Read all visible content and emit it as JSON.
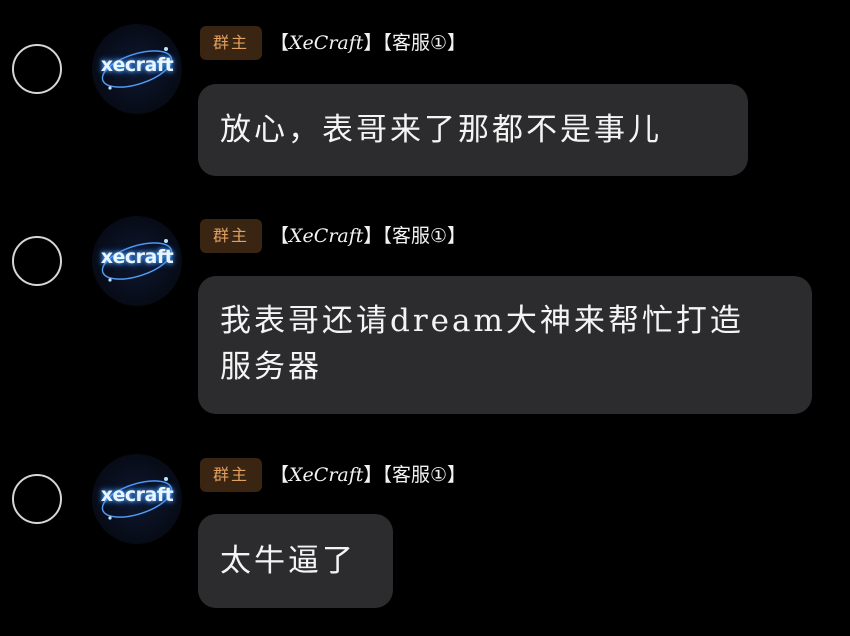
{
  "messages": [
    {
      "role_badge": "群主",
      "tag_open_1": "【",
      "sender_name": "XeCraft",
      "tag_close_1": "】",
      "tag_open_2": "【",
      "sender_role": "客服①",
      "tag_close_2": "】",
      "avatar_text": "xecraft",
      "lines": [
        "放心，表哥来了那都不是事儿"
      ]
    },
    {
      "role_badge": "群主",
      "tag_open_1": "【",
      "sender_name": "XeCraft",
      "tag_close_1": "】",
      "tag_open_2": "【",
      "sender_role": "客服①",
      "tag_close_2": "】",
      "avatar_text": "xecraft",
      "lines": [
        "我表哥还请dream大神来帮忙打造",
        "服务器"
      ]
    },
    {
      "role_badge": "群主",
      "tag_open_1": "【",
      "sender_name": "XeCraft",
      "tag_close_1": "】",
      "tag_open_2": "【",
      "sender_role": "客服①",
      "tag_close_2": "】",
      "avatar_text": "xecraft",
      "lines": [
        "太牛逼了"
      ]
    }
  ],
  "colors": {
    "background": "#000000",
    "bubble": "#2c2c2e",
    "badge_bg": "#3a2412",
    "badge_text": "#e0a05f",
    "avatar_glow": "#5fb2ff"
  },
  "icons": {
    "select": "radio-circle-icon",
    "avatar": "xecraft-logo-icon"
  }
}
